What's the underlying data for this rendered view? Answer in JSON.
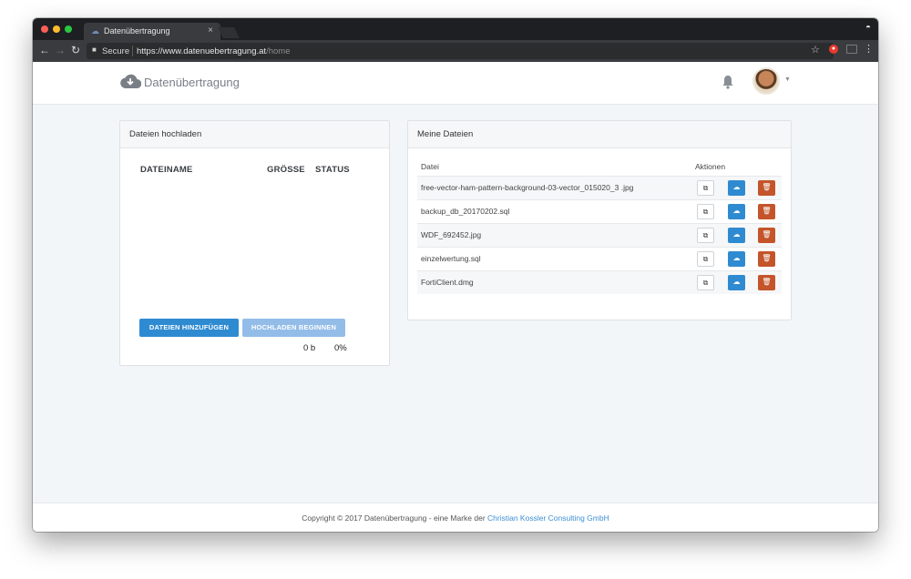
{
  "browser": {
    "tab_title": "Datenübertragung",
    "tab_close": "×",
    "secure_label": "Secure",
    "url_host": "https://www.datenuebertragung.at",
    "url_path": "/home"
  },
  "header": {
    "brand": "Datenübertragung"
  },
  "upload_panel": {
    "title": "Dateien hochladen",
    "columns": [
      "DATEINAME",
      "GRÖSSE",
      "STATUS"
    ],
    "add_button": "DATEIEN HINZUFÜGEN",
    "start_button": "HOCHLADEN BEGINNEN",
    "total_size": "0 b",
    "total_percent": "0%"
  },
  "files_panel": {
    "title": "Meine Dateien",
    "col_file": "Datei",
    "col_actions": "Aktionen",
    "files": [
      "free-vector-ham-pattern-background-03-vector_015020_3 .jpg",
      "backup_db_20170202.sql",
      "WDF_692452.jpg",
      "einzelwertung.sql",
      "FortiClient.dmg"
    ]
  },
  "footer": {
    "text": "Copyright © 2017 Datenübertragung - eine Marke der ",
    "link": "Christian Kossler Consulting GmbH"
  },
  "colors": {
    "primary": "#2f8bd1",
    "primary_disabled": "#93bde8",
    "danger": "#c4552a",
    "link": "#3b8fd4"
  }
}
